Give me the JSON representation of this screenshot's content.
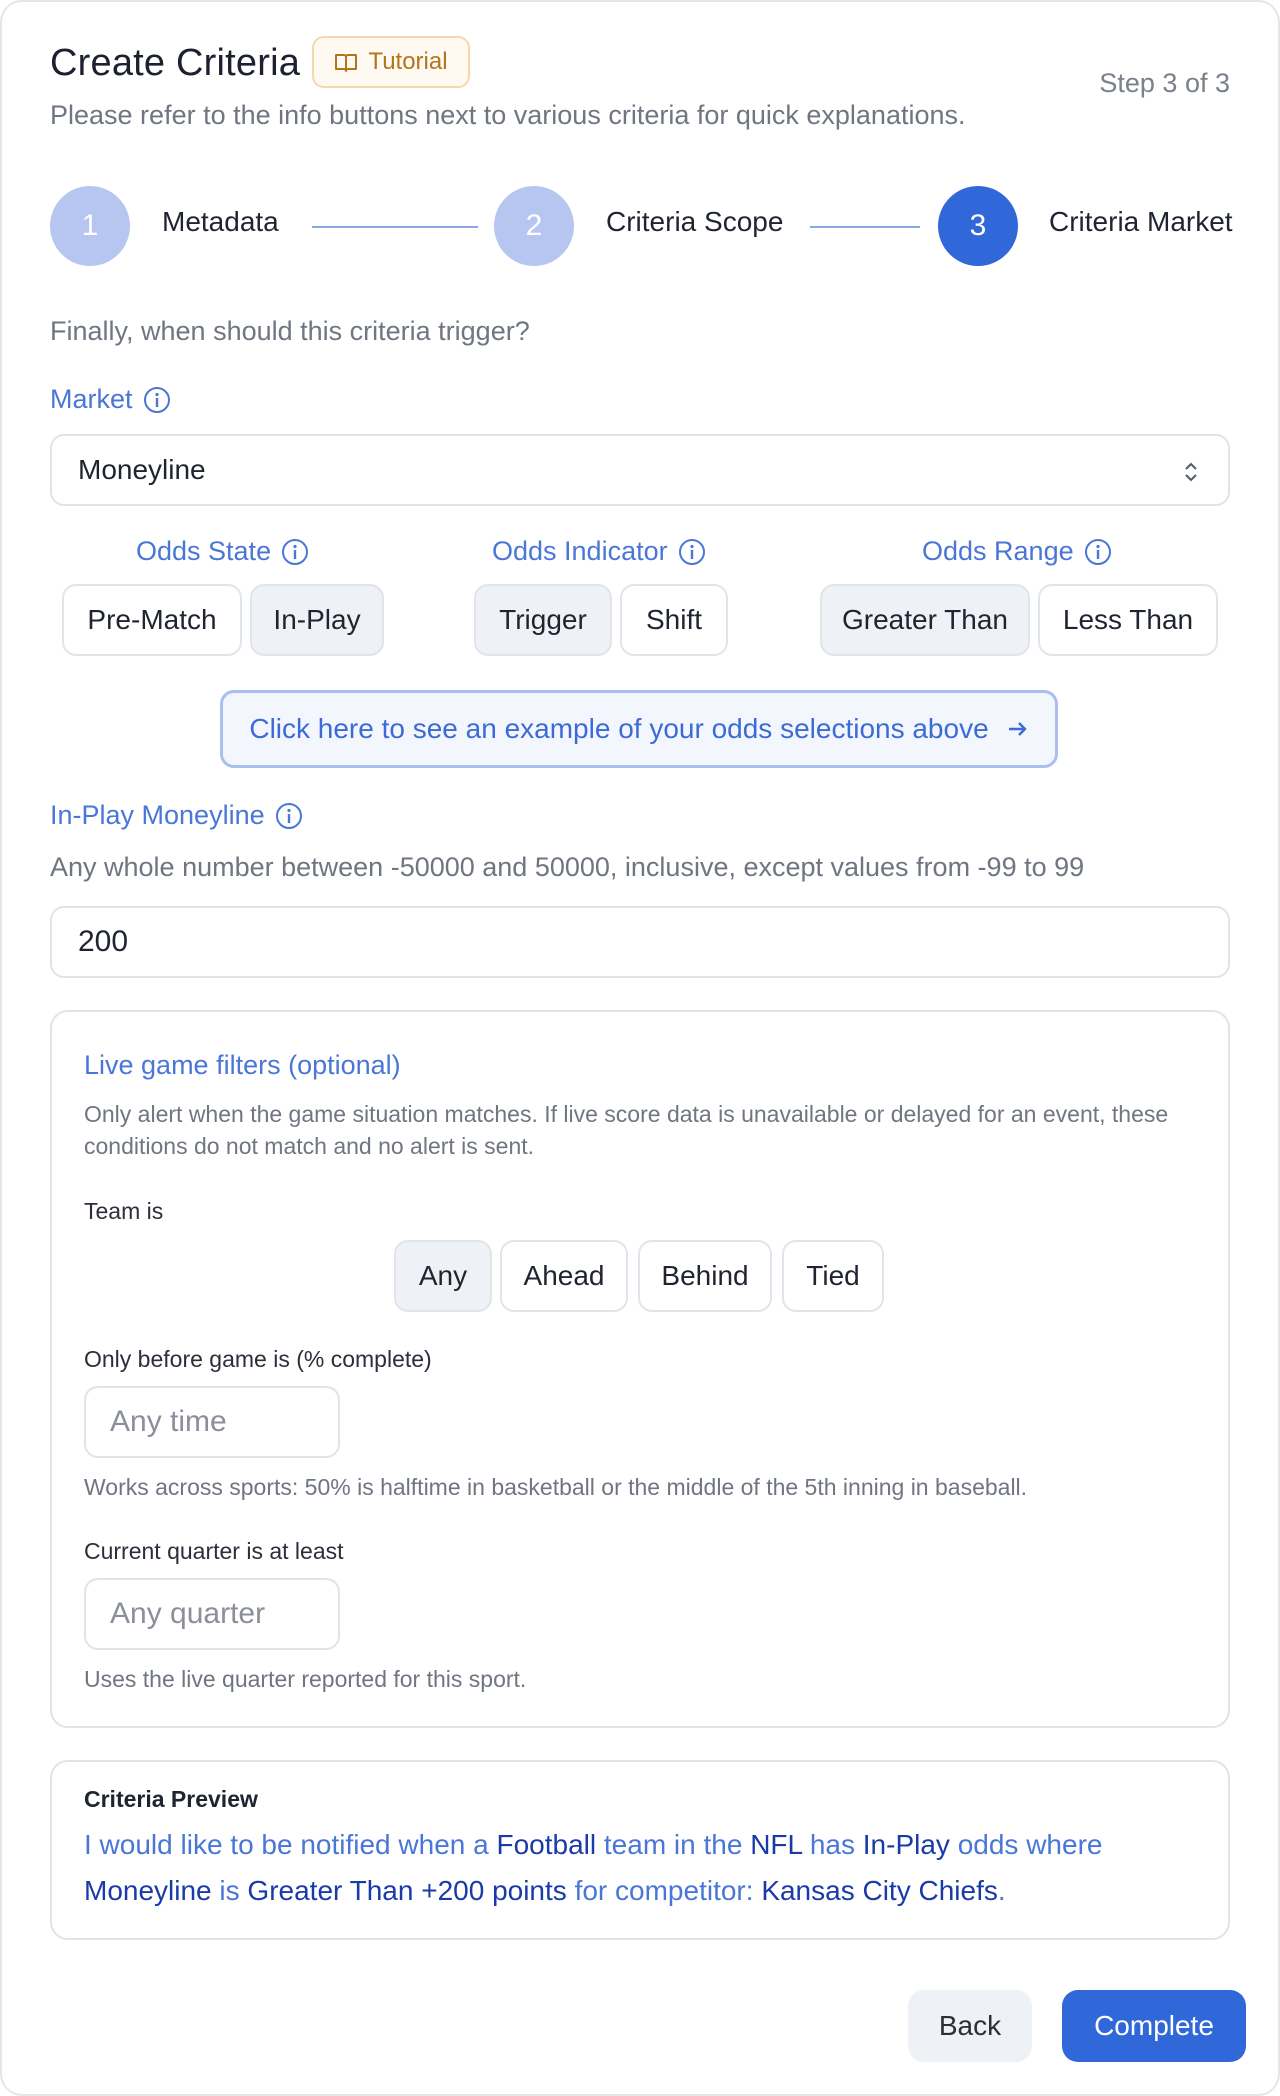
{
  "header": {
    "title": "Create Criteria",
    "tutorial_label": "Tutorial",
    "tutorial_icon": "book-icon",
    "step_label": "Step 3 of 3",
    "subtitle": "Please refer to the info buttons next to various criteria for quick explanations."
  },
  "stepper": [
    {
      "number": "1",
      "label": "Metadata",
      "state": "done"
    },
    {
      "number": "2",
      "label": "Criteria Scope",
      "state": "done"
    },
    {
      "number": "3",
      "label": "Criteria Market",
      "state": "active"
    }
  ],
  "question": "Finally, when should this criteria trigger?",
  "market": {
    "label": "Market",
    "value": "Moneyline"
  },
  "odds_state": {
    "label": "Odds State",
    "options": [
      "Pre-Match",
      "In-Play"
    ],
    "selected": "In-Play"
  },
  "odds_indicator": {
    "label": "Odds Indicator",
    "options": [
      "Trigger",
      "Shift"
    ],
    "selected": "Trigger"
  },
  "odds_range": {
    "label": "Odds Range",
    "options": [
      "Greater Than",
      "Less Than"
    ],
    "selected": "Greater Than"
  },
  "example_button": "Click here to see an example of your odds selections above",
  "moneyline": {
    "label": "In-Play Moneyline",
    "hint": "Any whole number between -50000 and 50000, inclusive, except values from -99 to 99",
    "value": "200"
  },
  "live_filters": {
    "title": "Live game filters (optional)",
    "description": "Only alert when the game situation matches. If live score data is unavailable or delayed for an event, these conditions do not match and no alert is sent.",
    "team_label": "Team is",
    "team_options": [
      "Any",
      "Ahead",
      "Behind",
      "Tied"
    ],
    "team_selected": "Any",
    "before_label": "Only before game is (% complete)",
    "before_placeholder": "Any time",
    "before_hint": "Works across sports: 50% is halftime in basketball or the middle of the 5th inning in baseball.",
    "quarter_label": "Current quarter is at least",
    "quarter_placeholder": "Any quarter",
    "quarter_hint": "Uses the live quarter reported for this sport."
  },
  "preview": {
    "title": "Criteria Preview",
    "t1": "I would like to be notified when a ",
    "sport": "Football",
    "t2": " team in the ",
    "league": "NFL",
    "t3": " has ",
    "state": "In-Play",
    "t4": " odds where",
    "market": "Moneyline",
    "t5": " is ",
    "range": "Greater Than +200 points",
    "t6": " for competitor: ",
    "competitor": "Kansas City Chiefs",
    "t7": "."
  },
  "footer": {
    "back_label": "Back",
    "complete_label": "Complete"
  },
  "colors": {
    "accent": "#3068d9",
    "accent_light": "#b6c6f1",
    "label_blue": "#4a76d8",
    "tutorial_border": "#f5d9a8",
    "tutorial_text": "#b3741e"
  }
}
